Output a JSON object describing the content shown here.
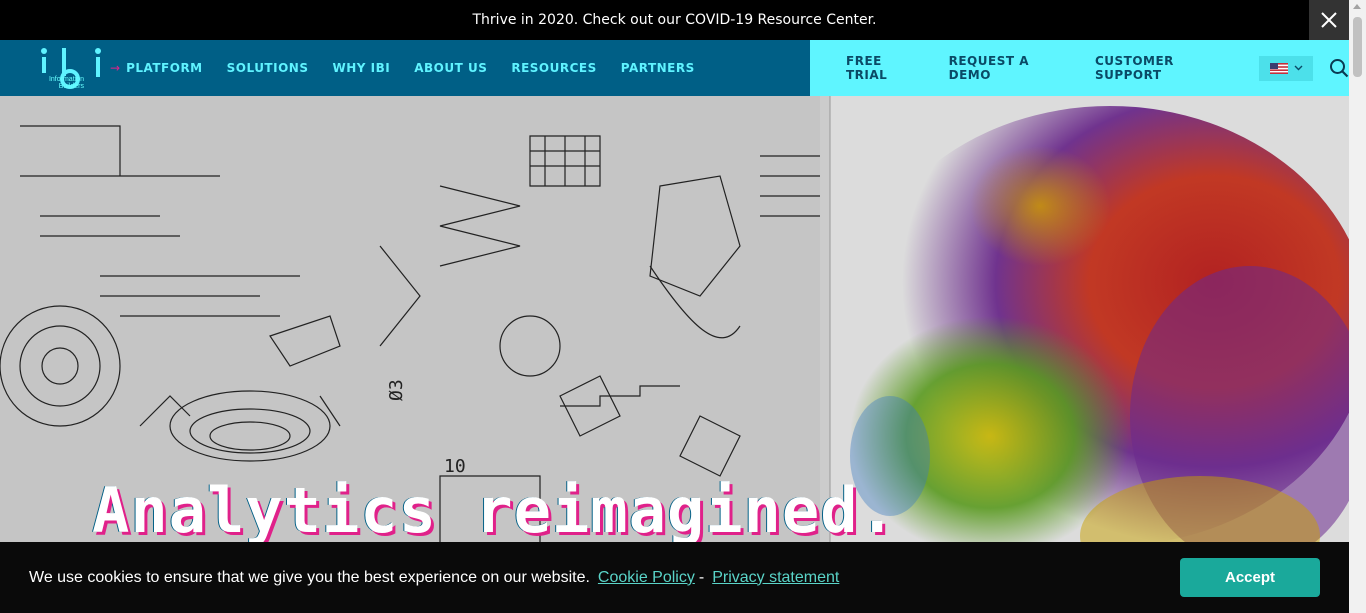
{
  "announcement": {
    "text": "Thrive in 2020. Check out our COVID-19 Resource Center.",
    "close_icon": "close-icon"
  },
  "logo": {
    "mark": "ibi",
    "line1": "Information",
    "line2": "Builders"
  },
  "nav": {
    "arrow": "→",
    "items": [
      "PLATFORM",
      "SOLUTIONS",
      "WHY IBI",
      "ABOUT US",
      "RESOURCES",
      "PARTNERS"
    ],
    "right_items": [
      "FREE TRIAL",
      "REQUEST A DEMO",
      "CUSTOMER SUPPORT"
    ],
    "language_flag": "us-flag-icon",
    "chevron": "chevron-down-icon",
    "search_icon": "search-icon"
  },
  "hero": {
    "headline": "Analytics reimagined."
  },
  "cookie": {
    "message": "We use cookies to ensure that we give you the best experience on our website.",
    "policy_link": "Cookie Policy",
    "separator": "-",
    "privacy_link": "Privacy statement",
    "accept_label": "Accept"
  },
  "colors": {
    "nav_dark": "#005f86",
    "nav_light": "#5ff5ff",
    "accent_pink": "#e0218a",
    "accept_green": "#1aa99b"
  }
}
